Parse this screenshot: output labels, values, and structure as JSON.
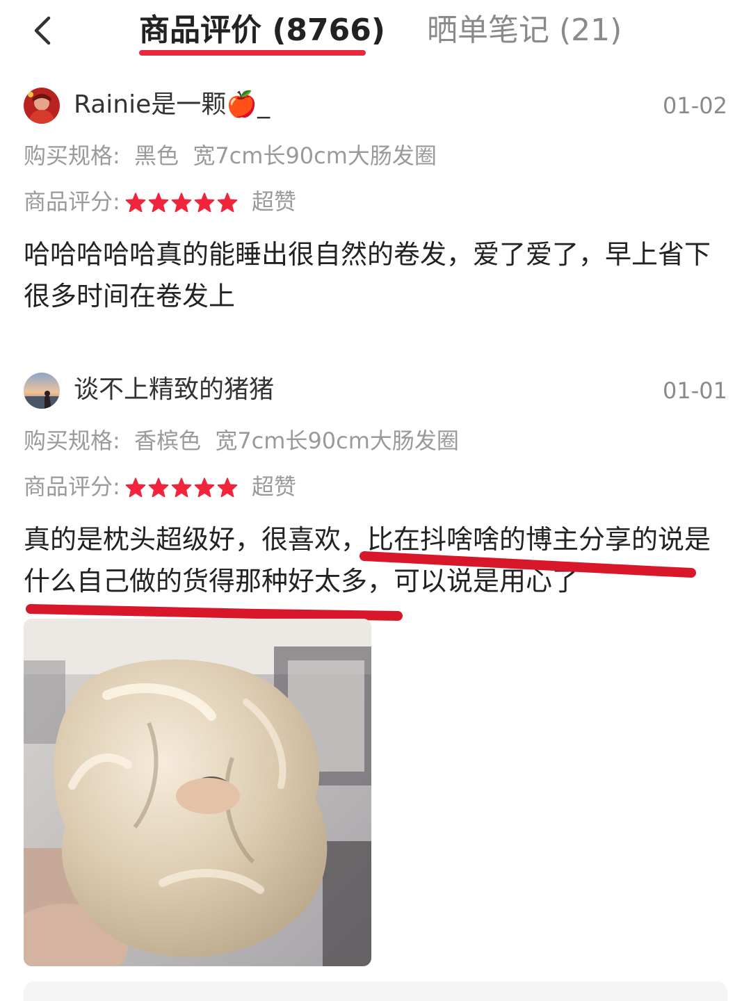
{
  "header": {
    "back_icon": "chevron-left-icon",
    "tabs": [
      {
        "label": "商品评价 (8766)",
        "active": true
      },
      {
        "label": "晒单笔记 (21)",
        "active": false
      }
    ],
    "accent_color": "#e8283e"
  },
  "reviews": [
    {
      "username": "Rainie是一颗🍎_",
      "date": "01-02",
      "spec_label": "购买规格:",
      "spec_value": "黑色  宽7cm长90cm大肠发圈",
      "rating_label": "商品评分:",
      "stars": 5,
      "rating_text": "超赞",
      "text": "哈哈哈哈哈真的能睡出很自然的卷发，爱了爱了，早上省下很多时间在卷发上"
    },
    {
      "username": "谈不上精致的猪猪",
      "date": "01-01",
      "spec_label": "购买规格:",
      "spec_value": "香槟色  宽7cm长90cm大肠发圈",
      "rating_label": "商品评分:",
      "stars": 5,
      "rating_text": "超赞",
      "text": "真的是枕头超级好，很喜欢，比在抖啥啥的博主分享的说是什么自己做的货得那种好太多，可以说是用心了",
      "has_photo": true
    }
  ],
  "star_color": "#f0253c",
  "annotation_color": "#d8172b"
}
